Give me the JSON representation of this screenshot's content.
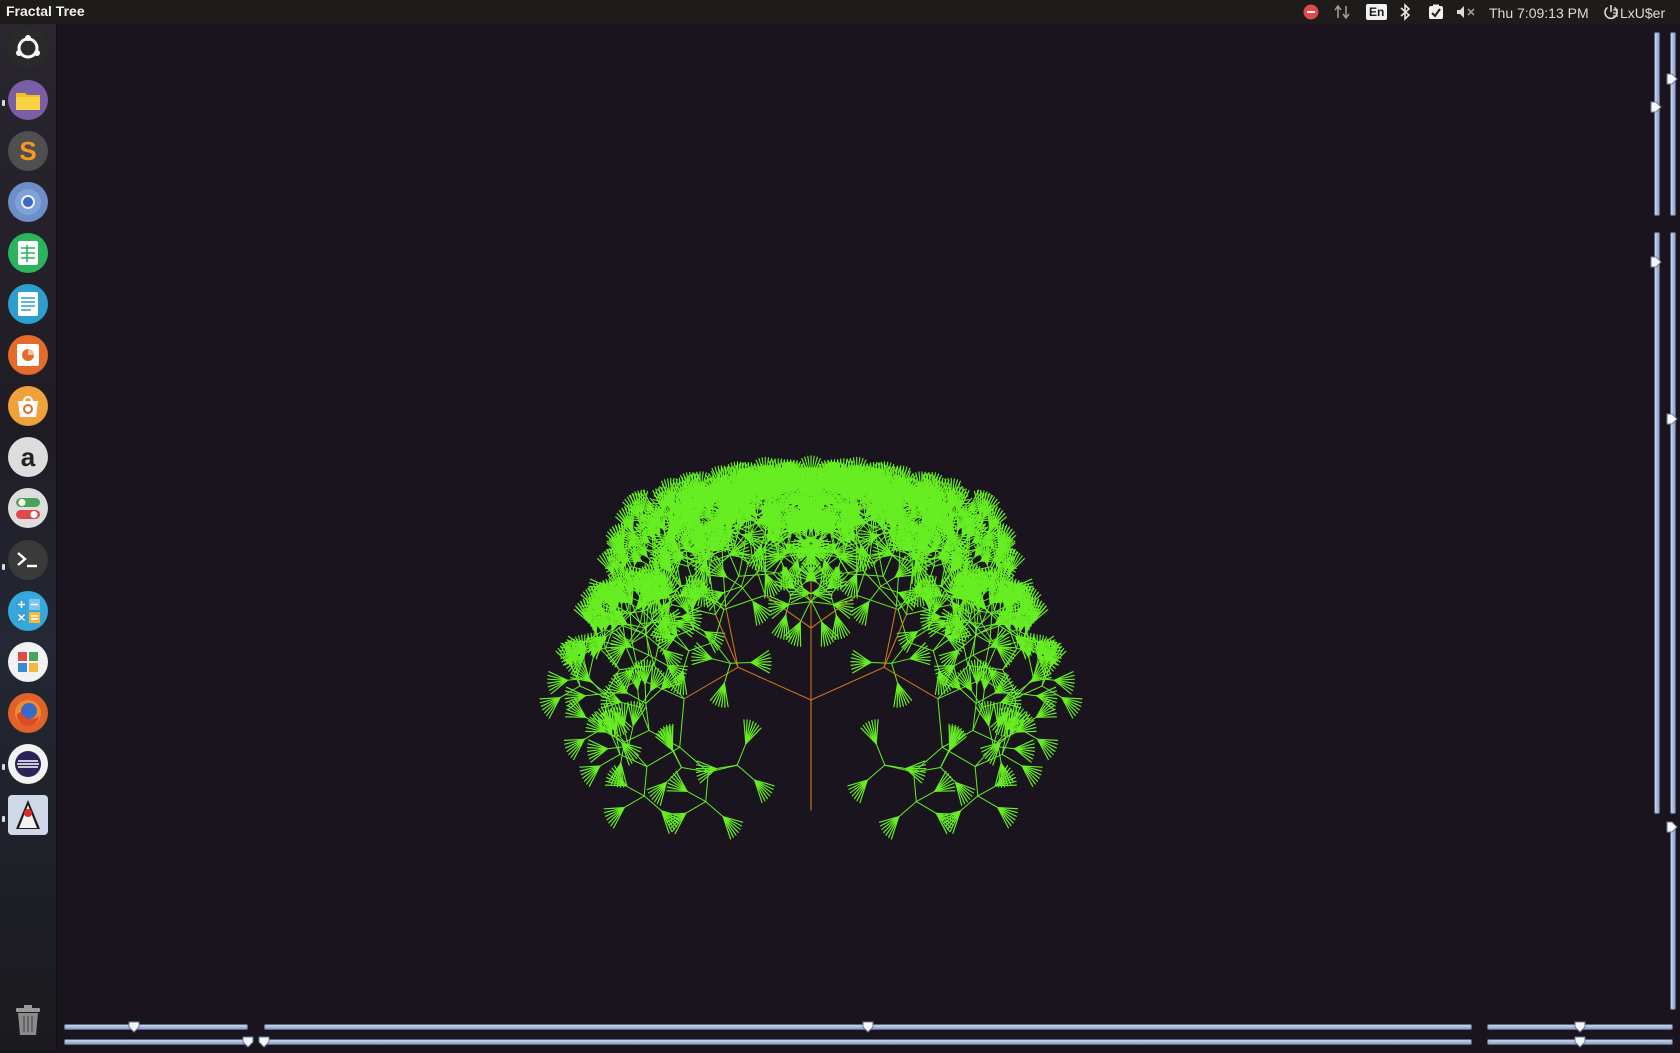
{
  "top_panel": {
    "app_title": "Fractal Tree",
    "language": "En",
    "clock": "Thu  7:09:13 PM",
    "user": "LxU$er",
    "icons": [
      "stop-icon",
      "network-icon",
      "bluetooth-icon",
      "updates-icon",
      "mute-icon",
      "power-icon"
    ]
  },
  "launcher": {
    "items": [
      {
        "name": "ubuntu-dash",
        "color": "#2a2a2a"
      },
      {
        "name": "files",
        "color": "#7b5fa6"
      },
      {
        "name": "sublime-text",
        "color": "#4f4f4f"
      },
      {
        "name": "chromium",
        "color": "#6d8fc8"
      },
      {
        "name": "libreoffice-calc",
        "color": "#2bb35e"
      },
      {
        "name": "libreoffice-writer",
        "color": "#2d9fcc"
      },
      {
        "name": "libreoffice-impress",
        "color": "#e46b2a"
      },
      {
        "name": "ubuntu-software",
        "color": "#f0a13a"
      },
      {
        "name": "amazon",
        "color": "#dddddd"
      },
      {
        "name": "system-settings",
        "color": "#dddddd"
      },
      {
        "name": "terminal",
        "color": "#3a3a3a"
      },
      {
        "name": "calculator",
        "color": "#35a8dc"
      },
      {
        "name": "app-grid",
        "color": "#f2f2f2"
      },
      {
        "name": "firefox",
        "color": "#e0612a"
      },
      {
        "name": "eclipse",
        "color": "#f2f2f2"
      },
      {
        "name": "java-duke",
        "color": "#cfd8e8"
      },
      {
        "name": "trash",
        "color": "#6a6a6a"
      }
    ]
  },
  "tree": {
    "leaf_color": "#66ee22",
    "trunk_color": "#c8741e",
    "background": "#19141d"
  },
  "sliders": {
    "bottom": [
      {
        "name": "slider-bottom-1",
        "level": 0.38
      },
      {
        "name": "slider-bottom-2",
        "level": 0.5
      },
      {
        "name": "slider-bottom-3",
        "level": 0.5
      },
      {
        "name": "slider-bottom-4",
        "level": 0.99
      },
      {
        "name": "slider-bottom-5",
        "level": 0.0
      },
      {
        "name": "slider-bottom-6",
        "level": 0.5
      }
    ],
    "right": [
      {
        "name": "slider-right-1",
        "level": 0.6
      },
      {
        "name": "slider-right-2",
        "level": 0.75
      },
      {
        "name": "slider-right-3",
        "level": 0.95
      },
      {
        "name": "slider-right-4",
        "level": 0.68
      },
      {
        "name": "slider-right-5",
        "level": 1.0
      }
    ]
  }
}
